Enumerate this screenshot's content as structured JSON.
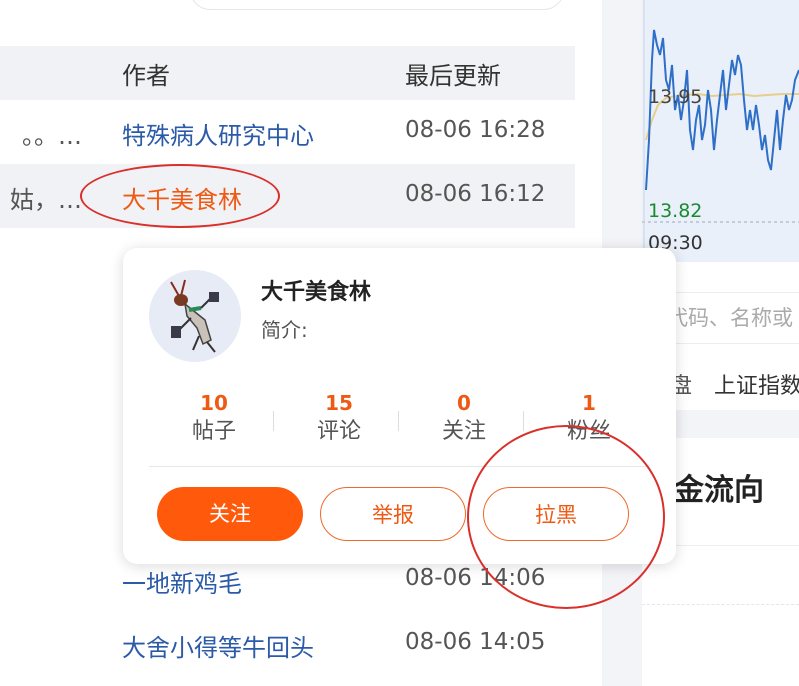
{
  "table": {
    "headers": {
      "author": "作者",
      "updated": "最后更新"
    },
    "rows": [
      {
        "title": "。。…",
        "author": "特殊病人研究中心",
        "time": "08-06 16:28"
      },
      {
        "title": "姑，…",
        "author": "大千美食林",
        "time": "08-06 16:12"
      },
      {
        "title": "",
        "author": "一地新鸡毛",
        "time": "08-06 14:06"
      },
      {
        "title": "",
        "author": "大舍小得等牛回头",
        "time": "08-06 14:05"
      }
    ]
  },
  "popup": {
    "name": "大千美食林",
    "intro": "简介:",
    "stats": [
      {
        "num": "10",
        "label": "帖子"
      },
      {
        "num": "15",
        "label": "评论"
      },
      {
        "num": "0",
        "label": "关注"
      },
      {
        "num": "1",
        "label": "粉丝"
      }
    ],
    "buttons": {
      "follow": "关注",
      "report": "举报",
      "block": "拉黑"
    }
  },
  "right_panel": {
    "price_high": "13.95",
    "price_low": "13.82",
    "time_start": "09:30",
    "search_placeholder": "输代码、名称或",
    "tab_partial": "盘",
    "tab_index": "上证指数",
    "fund_title": "金流向"
  },
  "colors": {
    "accent": "#ff5a0c",
    "author_link": "#2b5aa8",
    "highlight_ring": "#d9302b",
    "price_low": "#1a8a2e"
  }
}
